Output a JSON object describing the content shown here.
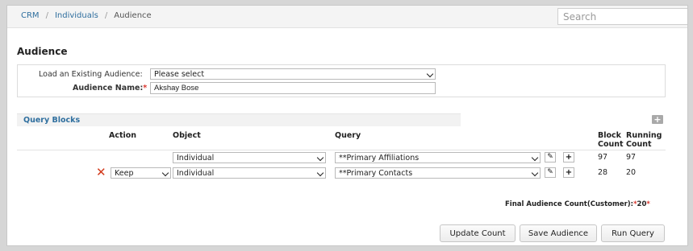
{
  "breadcrumb": {
    "items": [
      "CRM",
      "Individuals"
    ],
    "separator": "/",
    "current": "Audience"
  },
  "search": {
    "placeholder": "Search"
  },
  "page": {
    "title": "Audience"
  },
  "form": {
    "load_label": "Load an Existing Audience:",
    "load_value": "Please select",
    "name_label": "Audience Name:",
    "required_mark": "*",
    "name_value": "Akshay Bose"
  },
  "query_blocks": {
    "title": "Query Blocks",
    "add_icon": "plus-icon",
    "headers": {
      "action": "Action",
      "object": "Object",
      "query": "Query",
      "block_count_line1": "Block",
      "block_count_line2": "Count",
      "running_count_line1": "Running",
      "running_count_line2": "Count"
    },
    "rows": [
      {
        "action": "",
        "object": "Individual",
        "query": "**Primary Affiliations",
        "block_count": "97",
        "running_count": "97"
      },
      {
        "action": "Keep",
        "object": "Individual",
        "query": "**Primary Contacts",
        "block_count": "28",
        "running_count": "20"
      }
    ]
  },
  "final_count": {
    "label": "Final Audience Count(Customer):",
    "value": "20",
    "required_mark": "*"
  },
  "buttons": {
    "update": "Update Count",
    "save": "Save Audience",
    "run": "Run Query"
  },
  "colors": {
    "link": "#2e6e9e",
    "required": "#d9342b",
    "delete": "#d23a1c"
  }
}
